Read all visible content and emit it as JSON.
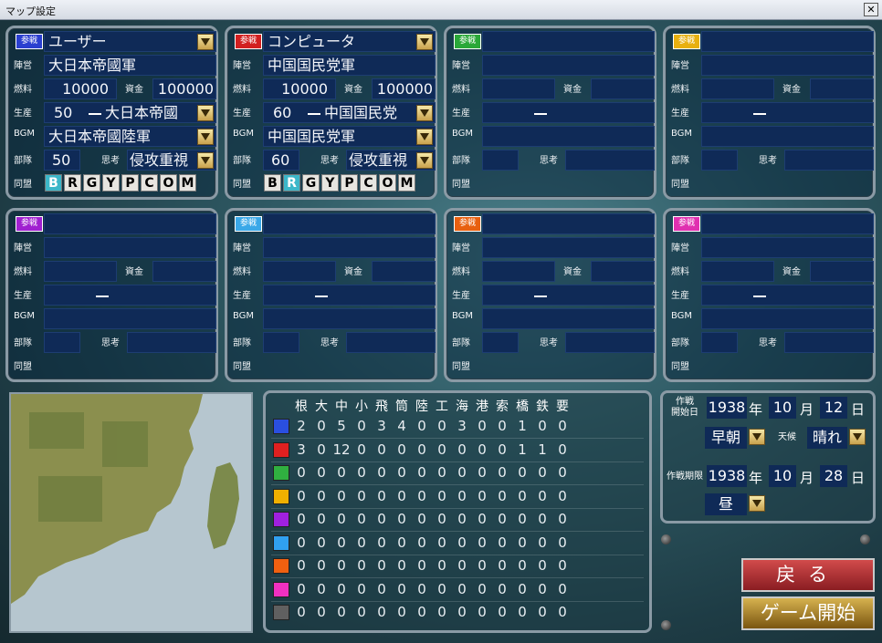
{
  "window": {
    "title": "マップ設定",
    "close": "✕"
  },
  "labels": {
    "sanka": "参戦",
    "jinei": "陣営",
    "nenryo": "燃料",
    "shikin": "資金",
    "seisan": "生産",
    "bgm": "BGM",
    "butai": "部隊",
    "shiko": "思考",
    "domei": "同盟",
    "dash": "ー"
  },
  "alliance_letters": [
    "B",
    "R",
    "G",
    "Y",
    "P",
    "C",
    "O",
    "M"
  ],
  "players": [
    {
      "color": "#2a3fd0",
      "type": "ユーザー",
      "faction": "大日本帝國軍",
      "fuel": "10000",
      "funds": "100000",
      "prod_value": "50",
      "prod_name": "大日本帝國",
      "bgm": "大日本帝國陸軍",
      "units": "50",
      "ai": "侵攻重視",
      "alliance_selected": "B"
    },
    {
      "color": "#d22020",
      "type": "コンピュータ",
      "faction": "中国国民党軍",
      "fuel": "10000",
      "funds": "100000",
      "prod_value": "60",
      "prod_name": "中国国民党",
      "bgm": "中国国民党軍",
      "units": "60",
      "ai": "侵攻重視",
      "alliance_selected": "R"
    },
    {
      "color": "#2aa838"
    },
    {
      "color": "#e8b010"
    },
    {
      "color": "#a020d0"
    },
    {
      "color": "#3aa8e8"
    },
    {
      "color": "#e86010"
    },
    {
      "color": "#e030b0"
    }
  ],
  "table": {
    "headers": [
      "根",
      "大",
      "中",
      "小",
      "飛",
      "筒",
      "陸",
      "工",
      "海",
      "港",
      "索",
      "橋",
      "鉄",
      "要"
    ],
    "rows": [
      {
        "color": "#2a4fe0",
        "values": [
          "2",
          "0",
          "5",
          "0",
          "3",
          "4",
          "0",
          "0",
          "3",
          "0",
          "0",
          "1",
          "0",
          "0"
        ]
      },
      {
        "color": "#e02020",
        "values": [
          "3",
          "0",
          "12",
          "0",
          "0",
          "0",
          "0",
          "0",
          "0",
          "0",
          "0",
          "1",
          "1",
          "0"
        ]
      },
      {
        "color": "#30b040",
        "values": [
          "0",
          "0",
          "0",
          "0",
          "0",
          "0",
          "0",
          "0",
          "0",
          "0",
          "0",
          "0",
          "0",
          "0"
        ]
      },
      {
        "color": "#f0b000",
        "values": [
          "0",
          "0",
          "0",
          "0",
          "0",
          "0",
          "0",
          "0",
          "0",
          "0",
          "0",
          "0",
          "0",
          "0"
        ]
      },
      {
        "color": "#a020e0",
        "values": [
          "0",
          "0",
          "0",
          "0",
          "0",
          "0",
          "0",
          "0",
          "0",
          "0",
          "0",
          "0",
          "0",
          "0"
        ]
      },
      {
        "color": "#30a0f0",
        "values": [
          "0",
          "0",
          "0",
          "0",
          "0",
          "0",
          "0",
          "0",
          "0",
          "0",
          "0",
          "0",
          "0",
          "0"
        ]
      },
      {
        "color": "#f06010",
        "values": [
          "0",
          "0",
          "0",
          "0",
          "0",
          "0",
          "0",
          "0",
          "0",
          "0",
          "0",
          "0",
          "0",
          "0"
        ]
      },
      {
        "color": "#f030c0",
        "values": [
          "0",
          "0",
          "0",
          "0",
          "0",
          "0",
          "0",
          "0",
          "0",
          "0",
          "0",
          "0",
          "0",
          "0"
        ]
      },
      {
        "color": "#606060",
        "values": [
          "0",
          "0",
          "0",
          "0",
          "0",
          "0",
          "0",
          "0",
          "0",
          "0",
          "0",
          "0",
          "0",
          "0"
        ]
      }
    ]
  },
  "schedule": {
    "start_label": "作戦\n開始日",
    "start_year": "1938",
    "start_month": "10",
    "start_day": "12",
    "nen": "年",
    "tsuki": "月",
    "hi": "日",
    "time_start": "早朝",
    "weather_label": "天候",
    "weather": "晴れ",
    "end_label": "作戦期限",
    "end_year": "1938",
    "end_month": "10",
    "end_day": "28",
    "time_end": "昼"
  },
  "buttons": {
    "back": "戻る",
    "start": "ゲーム開始"
  }
}
